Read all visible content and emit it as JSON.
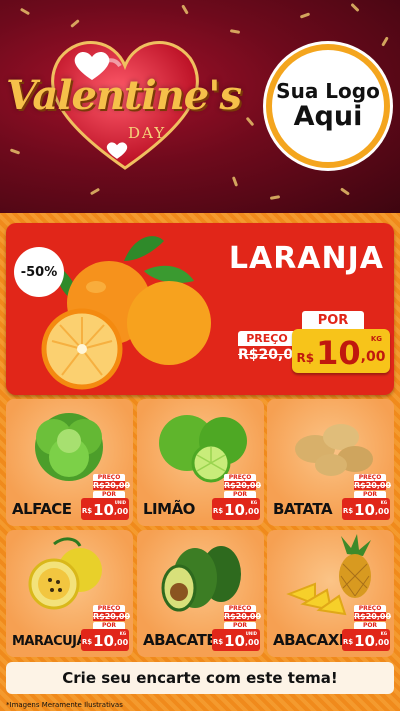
{
  "header": {
    "title_main": "Valentine's",
    "title_sub": "DAY",
    "logo_line1": "Sua Logo",
    "logo_line2": "Aqui"
  },
  "featured": {
    "name": "LARANJA",
    "discount": "-50%",
    "preco_label": "PREÇO",
    "old_price": "R$20,00",
    "por_label": "POR",
    "currency": "R$",
    "price_int": "10",
    "price_dec": ",00",
    "unit": "KG",
    "image_icon": "orange-icon"
  },
  "products": [
    {
      "name": "ALFACE",
      "preco_label": "PREÇO",
      "old_price": "R$20,00",
      "por_label": "POR",
      "currency": "R$",
      "price_int": "10",
      "price_dec": ",00",
      "unit": "UNID",
      "icon": "lettuce-icon"
    },
    {
      "name": "LIMÃO",
      "preco_label": "PREÇO",
      "old_price": "R$20,00",
      "por_label": "POR",
      "currency": "R$",
      "price_int": "10",
      "price_dec": ",00",
      "unit": "KG",
      "icon": "lime-icon"
    },
    {
      "name": "BATATA",
      "preco_label": "PREÇO",
      "old_price": "R$20,00",
      "por_label": "POR",
      "currency": "R$",
      "price_int": "10",
      "price_dec": ",00",
      "unit": "KG",
      "icon": "potato-icon"
    },
    {
      "name": "MARACUJÁ",
      "preco_label": "PREÇO",
      "old_price": "R$20,00",
      "por_label": "POR",
      "currency": "R$",
      "price_int": "10",
      "price_dec": ",00",
      "unit": "KG",
      "icon": "passion-fruit-icon"
    },
    {
      "name": "ABACATE",
      "preco_label": "PREÇO",
      "old_price": "R$20,00",
      "por_label": "POR",
      "currency": "R$",
      "price_int": "10",
      "price_dec": ",00",
      "unit": "UNID",
      "icon": "avocado-icon"
    },
    {
      "name": "ABACAXI",
      "preco_label": "PREÇO",
      "old_price": "R$20,00",
      "por_label": "POR",
      "currency": "R$",
      "price_int": "10",
      "price_dec": ",00",
      "unit": "KG",
      "icon": "pineapple-icon"
    }
  ],
  "cta": "Crie seu encarte com este tema!",
  "footnote": "*Imagens Meramente Ilustrativas",
  "colors": {
    "red": "#e12619",
    "orange": "#f08a1c",
    "yellow": "#f7c41a",
    "header": "#6e0a1c"
  }
}
